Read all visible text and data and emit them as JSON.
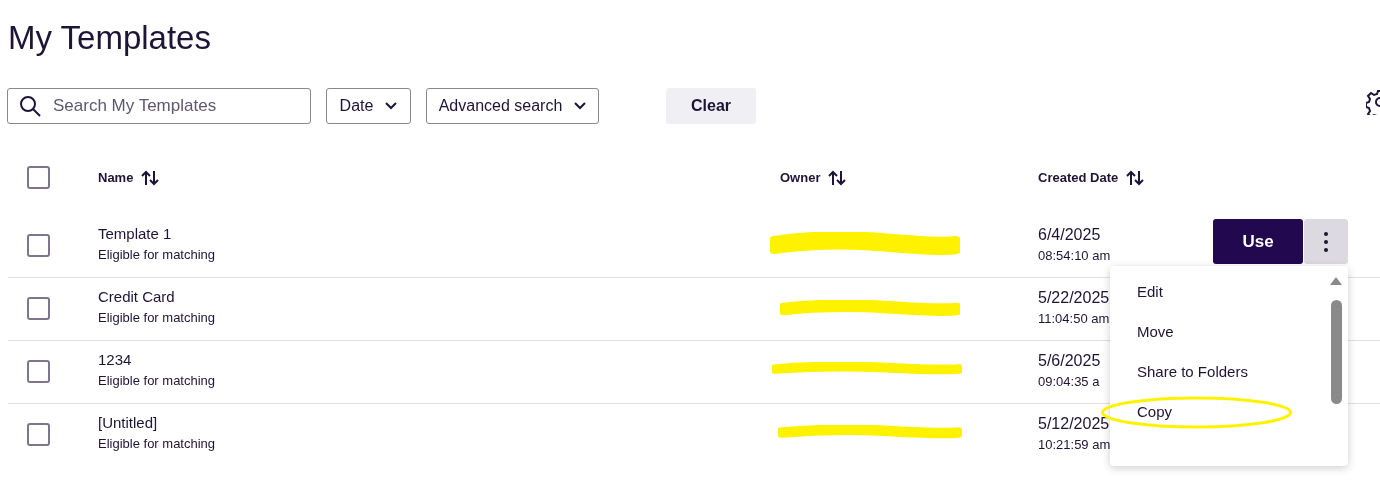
{
  "title": "My Templates",
  "search": {
    "placeholder": "Search My Templates"
  },
  "filters": [
    {
      "label": "Date"
    },
    {
      "label": "Advanced search"
    }
  ],
  "clear_button": "Clear",
  "table": {
    "select_all_checked": false,
    "columns": [
      "Name",
      "Owner",
      "Created Date"
    ],
    "rows": [
      {
        "checked": false,
        "name": "Template 1",
        "subtitle": "Eligible for matching",
        "date": "6/4/2025",
        "time": "08:54:10 am"
      },
      {
        "checked": false,
        "name": "Credit Card",
        "subtitle": "Eligible for matching",
        "date": "5/22/2025",
        "time": "11:04:50 am"
      },
      {
        "checked": false,
        "name": "1234",
        "subtitle": "Eligible for matching",
        "date": "5/6/2025",
        "time": "09:04:35 a"
      },
      {
        "checked": false,
        "name": "[Untitled]",
        "subtitle": "Eligible for matching",
        "date": "5/12/2025",
        "time": "10:21:59 am"
      }
    ]
  },
  "use_button": "Use",
  "menu": {
    "items": [
      {
        "label": "Edit",
        "circled": false
      },
      {
        "label": "Move",
        "circled": false
      },
      {
        "label": "Share to Folders",
        "circled": false
      },
      {
        "label": "Copy",
        "circled": true
      }
    ]
  }
}
